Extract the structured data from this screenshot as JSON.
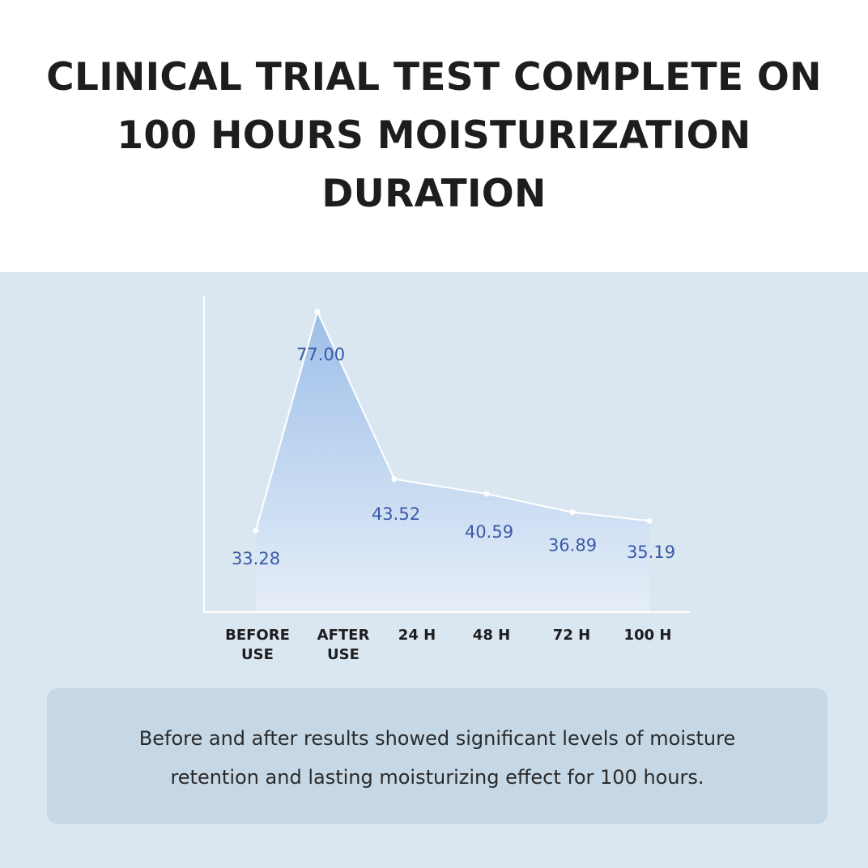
{
  "header": {
    "title_lines": [
      "CLINICAL TRIAL TEST COMPLETE ON",
      "100 HOURS MOISTURIZATION",
      "DURATION"
    ]
  },
  "chart_data": {
    "type": "area",
    "categories": [
      [
        "BEFORE",
        "USE"
      ],
      [
        "AFTER",
        "USE"
      ],
      [
        "24 H"
      ],
      [
        "48 H"
      ],
      [
        "72 H"
      ],
      [
        "100 H"
      ]
    ],
    "values": [
      33.28,
      77.0,
      43.52,
      40.59,
      36.89,
      35.19
    ],
    "value_labels": [
      "33.28",
      "77.00",
      "43.52",
      "40.59",
      "36.89",
      "35.19"
    ],
    "title": "",
    "xlabel": "",
    "ylabel": "",
    "grid": false,
    "colors": {
      "line": "#ffffff",
      "fill_top": "#9dbfe9",
      "fill_bottom": "#e6eef8",
      "value_label": "#3a5aa8",
      "axis": "#ffffff"
    }
  },
  "summary": {
    "text": "Before and after results showed significant levels of moisture\nretention and  lasting moisturizing effect for 100 hours."
  }
}
